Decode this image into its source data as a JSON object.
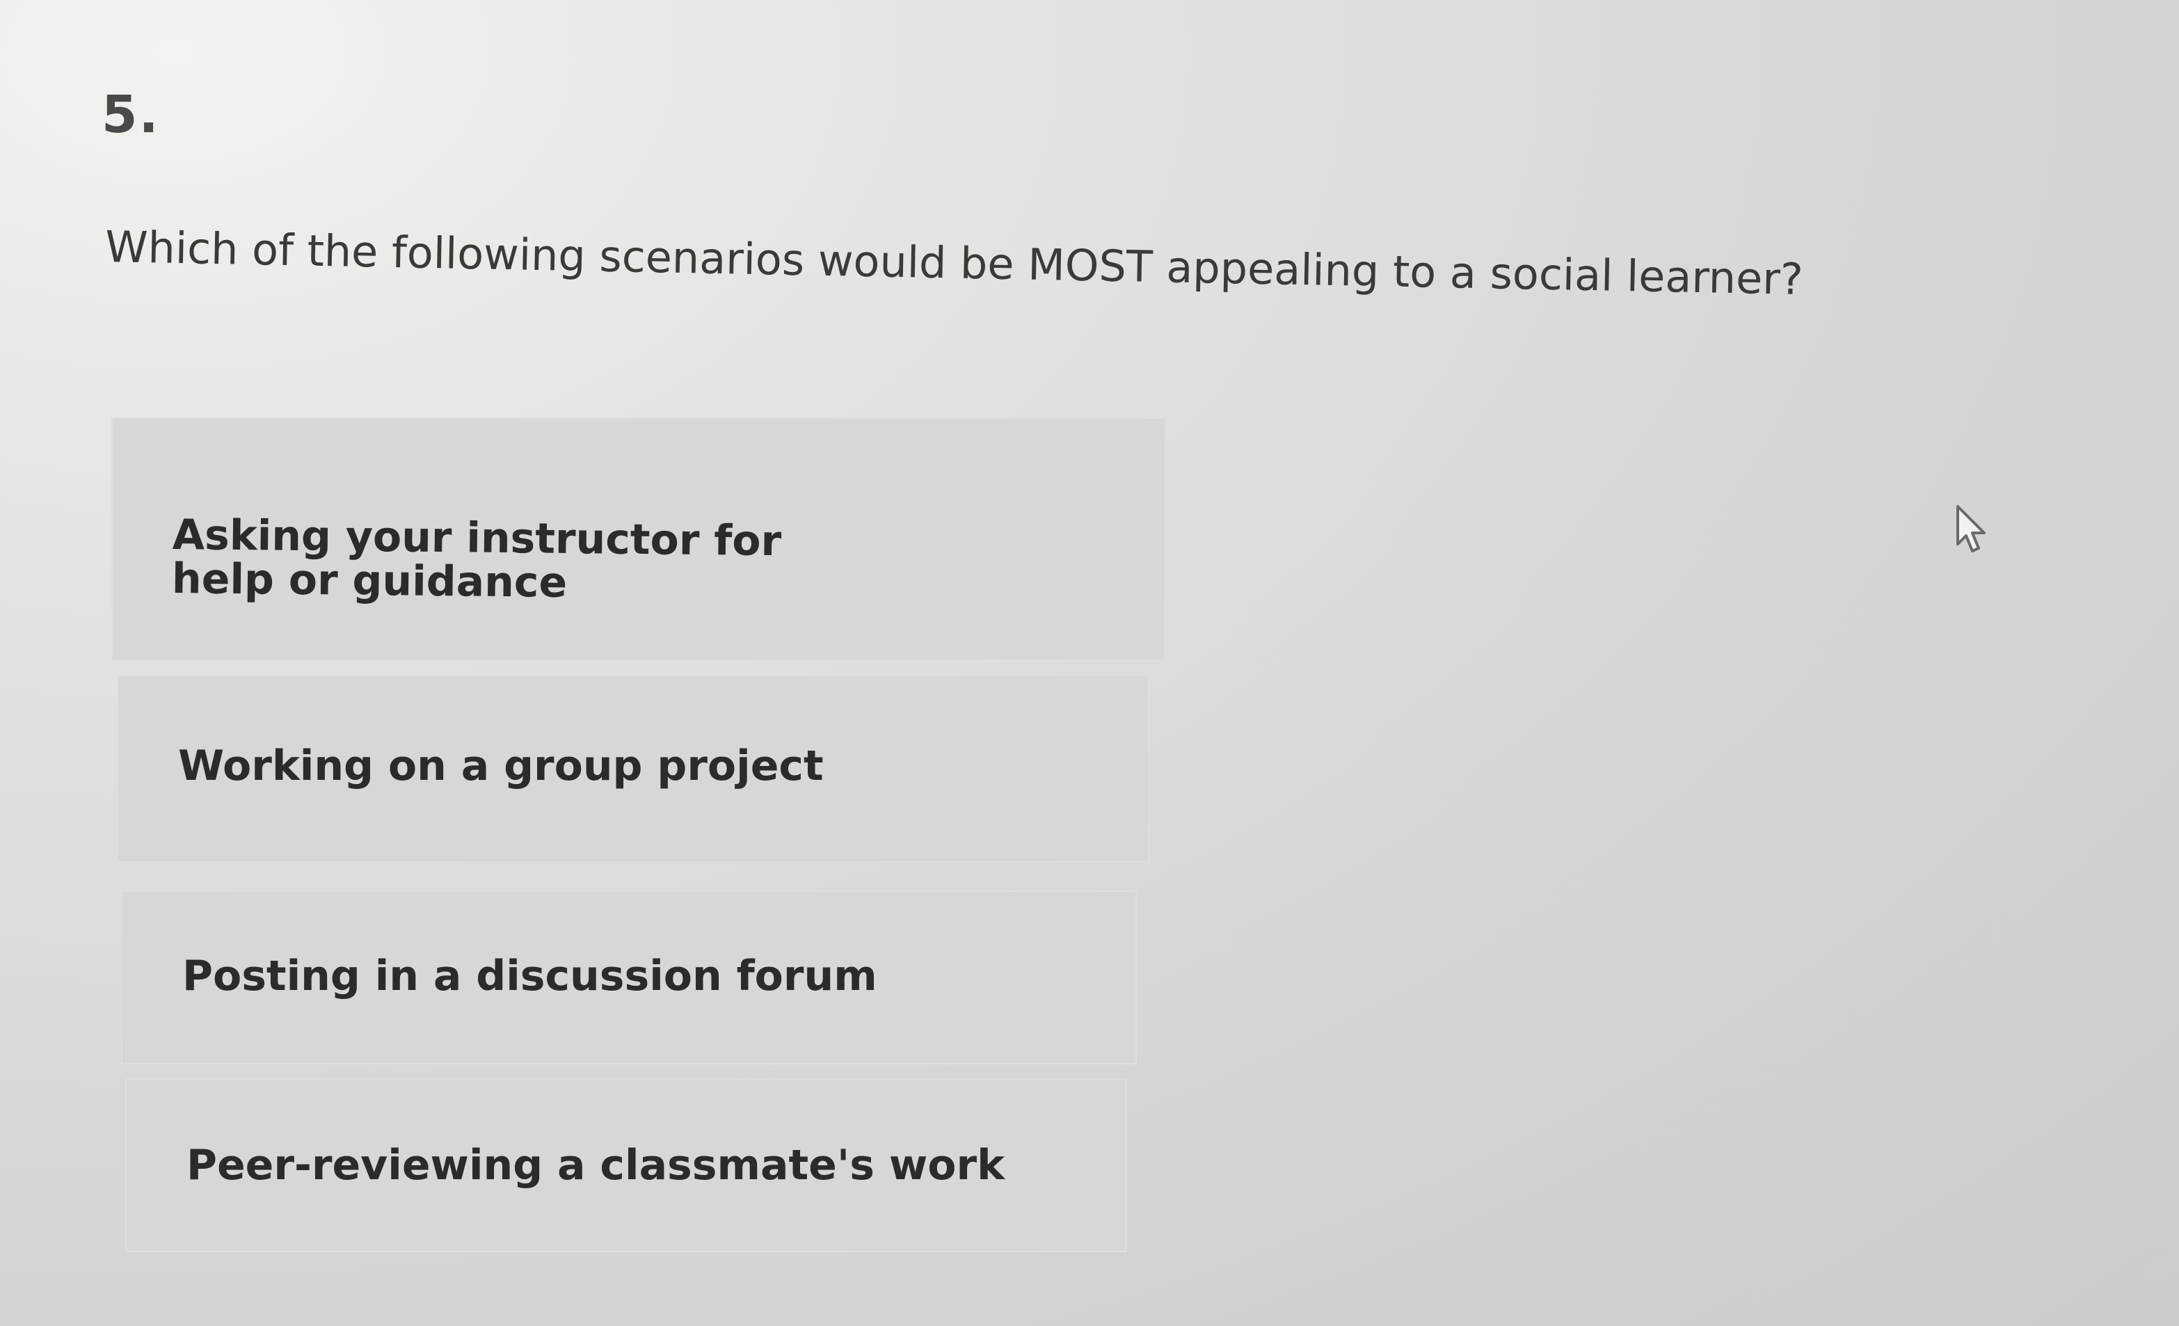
{
  "question": {
    "number": "5.",
    "text": "Which of the following scenarios would be MOST appealing to a social learner?"
  },
  "options": [
    {
      "label": "Asking your instructor for help or guidance"
    },
    {
      "label": "Working on a group project"
    },
    {
      "label": "Posting in a discussion forum"
    },
    {
      "label": "Peer-reviewing a classmate's work"
    }
  ],
  "colors": {
    "option_background": "#d7d7d6",
    "text": "#2b2b2b",
    "page_background": "#dcdcdb"
  },
  "icons": {
    "cursor": "mouse-pointer-icon"
  }
}
